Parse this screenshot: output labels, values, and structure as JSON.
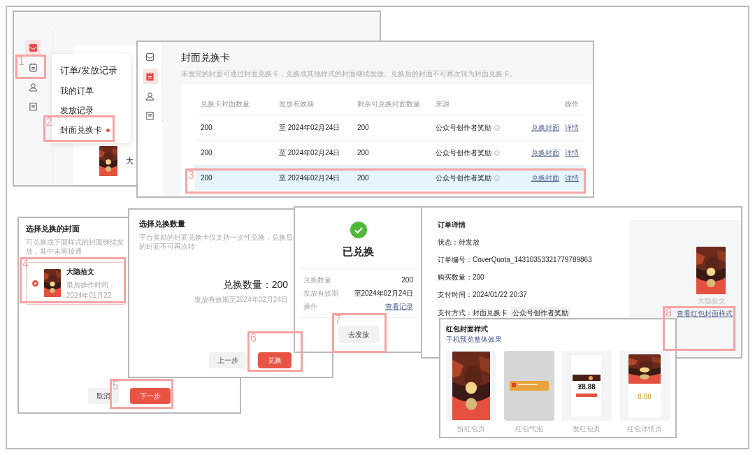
{
  "menu_screen": {
    "nav_icons": [
      {
        "kind": "cover",
        "selected": true
      },
      {
        "kind": "orders",
        "selected": false
      },
      {
        "kind": "users",
        "selected": false
      },
      {
        "kind": "docs",
        "selected": false
      }
    ],
    "background_texts": [
      "大"
    ],
    "menu": {
      "title": "订单/发放记录",
      "items": [
        {
          "label": "我的订单",
          "dot": false
        },
        {
          "label": "发放记录",
          "dot": false
        },
        {
          "label": "封面兑换卡",
          "dot": true
        }
      ]
    }
  },
  "card_list_screen": {
    "nav_icons": [
      {
        "kind": "cover",
        "selected": false
      },
      {
        "kind": "orders",
        "selected": true
      },
      {
        "kind": "users",
        "selected": false
      },
      {
        "kind": "docs",
        "selected": false
      }
    ],
    "title": "封面兑换卡",
    "description": "未发完的封面可通过封面兑换卡，兑换成其他样式的封面继续发放。兑换后的封面不可再次转为封面兑换卡。",
    "columns": [
      "兑换卡封面数量",
      "发放有效期",
      "剩余可兑换封面数量",
      "来源",
      "操作"
    ],
    "rows": [
      {
        "cells": [
          "200",
          "至 2024年02月24日",
          "200",
          "公众号创作者奖励"
        ],
        "actions": [
          "兑换封面",
          "详情"
        ],
        "selected": false
      },
      {
        "cells": [
          "200",
          "至 2024年02月24日",
          "200",
          "公众号创作者奖励"
        ],
        "actions": [
          "兑换封面",
          "详情"
        ],
        "selected": false
      },
      {
        "cells": [
          "200",
          "至 2024年02月24日",
          "200",
          "公众号创作者奖励"
        ],
        "actions": [
          "兑换封面",
          "详情"
        ],
        "selected": true
      }
    ]
  },
  "choose_cover_dialog": {
    "title": "选择兑换的封面",
    "description": "可兑换成下面样式的封面继续发放，其中未审核通",
    "options": [
      {
        "name": "大隐拾文",
        "time": "最后操作时间：2024年01月22",
        "selected": true
      }
    ],
    "buttons": [
      "取消",
      "下一步"
    ]
  },
  "choose_quantity_dialog": {
    "title": "选择兑换数量",
    "description": "平台奖励的封面兑换卡仅支持一次性兑换，兑换后的封面不可再次转",
    "quantity": "兑换数量：200",
    "validity": "发放有效期至2024年02月24日",
    "buttons": [
      "上一步",
      "兑换"
    ]
  },
  "success_dialog": {
    "title": "已兑换",
    "rows": [
      {
        "label": "兑换数量",
        "value": "200",
        "kind": "text"
      },
      {
        "label": "发放有效期",
        "value": "至2024年02月24日",
        "kind": "text"
      },
      {
        "label": "操作",
        "value": "查看记录",
        "kind": "link"
      }
    ],
    "button": "去发放"
  },
  "order_detail": {
    "title": "订单详情",
    "fields": [
      "状态：待发放",
      "订单编号：CoverQuota_14310353321779789863",
      "购买数量：200",
      "支付时间：2024/01/22 20:37",
      "支付方式：封面兑换卡"
    ],
    "payment_tag": "公众号创作者奖励",
    "cover_name": "大隐拾文",
    "preview_link": "查看红包封面样式"
  },
  "style_preview": {
    "title": "红包封面样式",
    "subtitle": "手机预览整体效果",
    "cards": [
      {
        "kind": "open",
        "label": "拆红包页"
      },
      {
        "kind": "bubble",
        "label": "红包气泡"
      },
      {
        "kind": "send",
        "label": "发红包页",
        "amount": "¥8.88"
      },
      {
        "kind": "detail",
        "label": "红包详情页",
        "amount": "8.88"
      }
    ]
  },
  "annotations": [
    {
      "number": "1"
    },
    {
      "number": "2"
    },
    {
      "number": "3"
    },
    {
      "number": "4"
    },
    {
      "number": "5"
    },
    {
      "number": "6"
    },
    {
      "number": "7"
    },
    {
      "number": "8"
    }
  ]
}
